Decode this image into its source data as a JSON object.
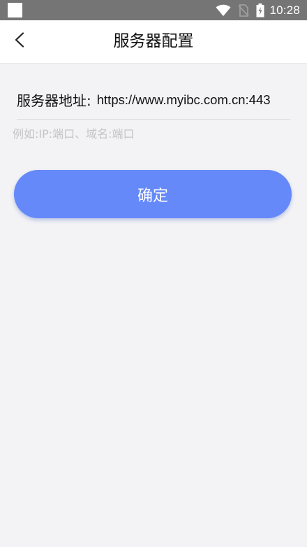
{
  "status_bar": {
    "time": "10:28",
    "icons": [
      "notification-square-icon",
      "wifi-icon",
      "no-sim-icon",
      "battery-charging-icon"
    ]
  },
  "header": {
    "title": "服务器配置",
    "back_icon": "chevron-left-icon"
  },
  "form": {
    "server_label": "服务器地址:",
    "server_value": "https://www.myibc.com.cn:443",
    "hint": "例如:IP:端口、域名:端口"
  },
  "actions": {
    "confirm_label": "确定"
  },
  "colors": {
    "status_bar_bg": "#757575",
    "page_bg": "#f3f3f5",
    "header_bg": "#ffffff",
    "accent": "#6589f8",
    "hint_text": "#c4c4c4"
  }
}
